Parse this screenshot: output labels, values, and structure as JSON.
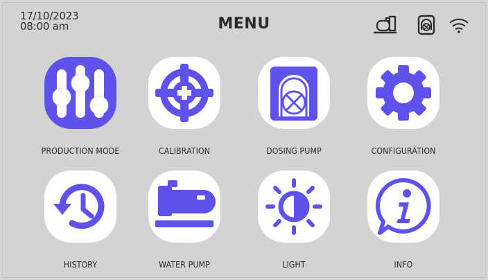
{
  "header": {
    "date": "17/10/2023",
    "time": "08:00 am",
    "title": "MENU"
  },
  "status_icons": [
    "water-pump-status-icon",
    "dosing-pump-status-icon",
    "wifi-icon"
  ],
  "menu": {
    "items": [
      {
        "label": "PRODUCTION MODE",
        "icon": "sliders-icon",
        "active": true
      },
      {
        "label": "CALIBRATION",
        "icon": "crosshair-icon",
        "active": false
      },
      {
        "label": "DOSING PUMP",
        "icon": "dosing-pump-icon",
        "active": false
      },
      {
        "label": "CONFIGURATION",
        "icon": "gear-icon",
        "active": false
      },
      {
        "label": "HISTORY",
        "icon": "history-icon",
        "active": false
      },
      {
        "label": "WATER PUMP",
        "icon": "water-pump-icon",
        "active": false
      },
      {
        "label": "LIGHT",
        "icon": "brightness-icon",
        "active": false
      },
      {
        "label": "INFO",
        "icon": "info-icon",
        "active": false
      }
    ]
  },
  "colors": {
    "accent": "#5f52ea",
    "background": "#d3d3d3",
    "tile": "#ffffff",
    "text": "#2b2b2b"
  }
}
